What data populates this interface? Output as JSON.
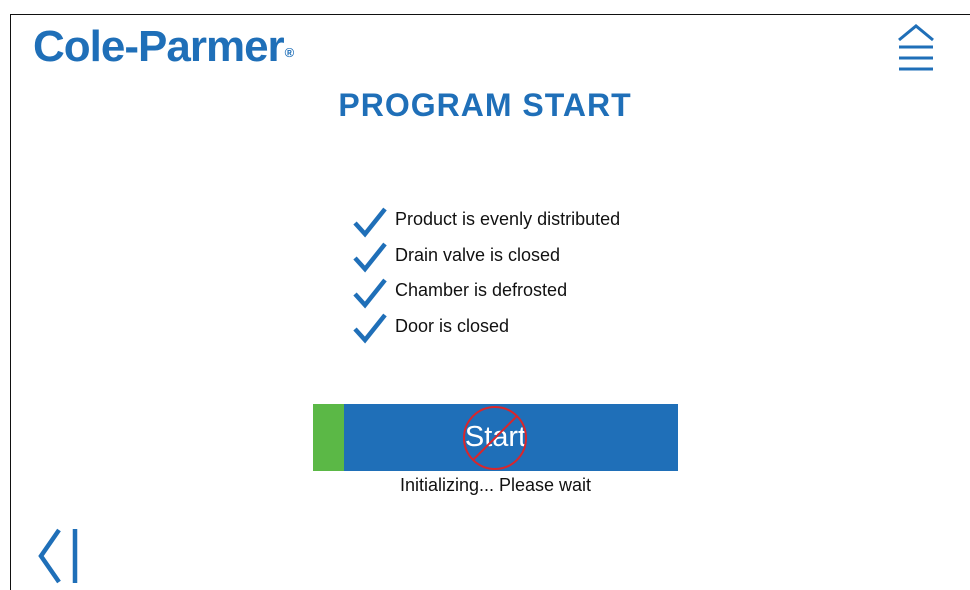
{
  "header": {
    "brand": "Cole-Parmer",
    "brand_mark": "®",
    "title": "PROGRAM START"
  },
  "checklist": {
    "items": [
      {
        "label": "Product is evenly distributed",
        "checked": true
      },
      {
        "label": "Drain valve is closed",
        "checked": true
      },
      {
        "label": "Chamber is defrosted",
        "checked": true
      },
      {
        "label": "Door is closed",
        "checked": true
      }
    ]
  },
  "start": {
    "label": "Start",
    "enabled": false,
    "progress": 0.085,
    "status": "Initializing... Please wait"
  },
  "icons": {
    "menu": "menu-icon",
    "back": "back-icon",
    "check": "check-icon",
    "disabled": "no-entry-icon"
  },
  "colors": {
    "brand": "#1f6fb8",
    "progress": "#5bb846",
    "disabled_sign": "#d9262b",
    "button_text": "#ffffff"
  }
}
